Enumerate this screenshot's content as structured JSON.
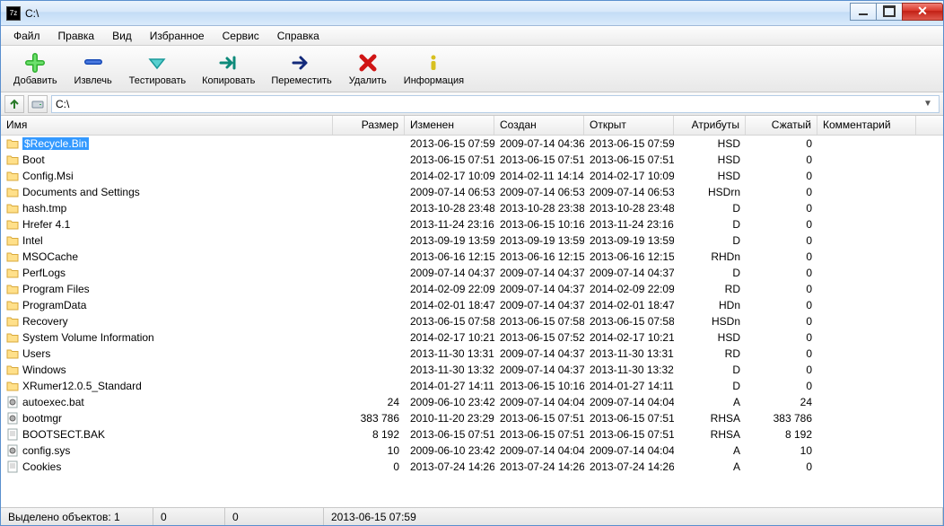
{
  "titlebar": {
    "title": "C:\\"
  },
  "menubar": {
    "items": [
      "Файл",
      "Правка",
      "Вид",
      "Избранное",
      "Сервис",
      "Справка"
    ]
  },
  "toolbar": {
    "buttons": [
      {
        "id": "add",
        "label": "Добавить"
      },
      {
        "id": "extract",
        "label": "Извлечь"
      },
      {
        "id": "test",
        "label": "Тестировать"
      },
      {
        "id": "copy",
        "label": "Копировать"
      },
      {
        "id": "move",
        "label": "Переместить"
      },
      {
        "id": "delete",
        "label": "Удалить"
      },
      {
        "id": "info",
        "label": "Информация"
      }
    ]
  },
  "path": {
    "value": "C:\\"
  },
  "columns": {
    "name": "Имя",
    "size": "Размер",
    "modified": "Изменен",
    "created": "Создан",
    "opened": "Открыт",
    "attrs": "Атрибуты",
    "packed": "Сжатый",
    "comment": "Комментарий"
  },
  "rows": [
    {
      "icon": "folder",
      "name": "$Recycle.Bin",
      "size": "",
      "modified": "2013-06-15 07:59",
      "created": "2009-07-14 04:36",
      "opened": "2013-06-15 07:59",
      "attrs": "HSD",
      "packed": "0",
      "selected": true
    },
    {
      "icon": "folder",
      "name": "Boot",
      "size": "",
      "modified": "2013-06-15 07:51",
      "created": "2013-06-15 07:51",
      "opened": "2013-06-15 07:51",
      "attrs": "HSD",
      "packed": "0"
    },
    {
      "icon": "folder",
      "name": "Config.Msi",
      "size": "",
      "modified": "2014-02-17 10:09",
      "created": "2014-02-11 14:14",
      "opened": "2014-02-17 10:09",
      "attrs": "HSD",
      "packed": "0"
    },
    {
      "icon": "folder",
      "name": "Documents and Settings",
      "size": "",
      "modified": "2009-07-14 06:53",
      "created": "2009-07-14 06:53",
      "opened": "2009-07-14 06:53",
      "attrs": "HSDrn",
      "packed": "0"
    },
    {
      "icon": "folder",
      "name": "hash.tmp",
      "size": "",
      "modified": "2013-10-28 23:48",
      "created": "2013-10-28 23:38",
      "opened": "2013-10-28 23:48",
      "attrs": "D",
      "packed": "0"
    },
    {
      "icon": "folder",
      "name": "Hrefer 4.1",
      "size": "",
      "modified": "2013-11-24 23:16",
      "created": "2013-06-15 10:16",
      "opened": "2013-11-24 23:16",
      "attrs": "D",
      "packed": "0"
    },
    {
      "icon": "folder",
      "name": "Intel",
      "size": "",
      "modified": "2013-09-19 13:59",
      "created": "2013-09-19 13:59",
      "opened": "2013-09-19 13:59",
      "attrs": "D",
      "packed": "0"
    },
    {
      "icon": "folder",
      "name": "MSOCache",
      "size": "",
      "modified": "2013-06-16 12:15",
      "created": "2013-06-16 12:15",
      "opened": "2013-06-16 12:15",
      "attrs": "RHDn",
      "packed": "0"
    },
    {
      "icon": "folder",
      "name": "PerfLogs",
      "size": "",
      "modified": "2009-07-14 04:37",
      "created": "2009-07-14 04:37",
      "opened": "2009-07-14 04:37",
      "attrs": "D",
      "packed": "0"
    },
    {
      "icon": "folder",
      "name": "Program Files",
      "size": "",
      "modified": "2014-02-09 22:09",
      "created": "2009-07-14 04:37",
      "opened": "2014-02-09 22:09",
      "attrs": "RD",
      "packed": "0"
    },
    {
      "icon": "folder",
      "name": "ProgramData",
      "size": "",
      "modified": "2014-02-01 18:47",
      "created": "2009-07-14 04:37",
      "opened": "2014-02-01 18:47",
      "attrs": "HDn",
      "packed": "0"
    },
    {
      "icon": "folder",
      "name": "Recovery",
      "size": "",
      "modified": "2013-06-15 07:58",
      "created": "2013-06-15 07:58",
      "opened": "2013-06-15 07:58",
      "attrs": "HSDn",
      "packed": "0"
    },
    {
      "icon": "folder",
      "name": "System Volume Information",
      "size": "",
      "modified": "2014-02-17 10:21",
      "created": "2013-06-15 07:52",
      "opened": "2014-02-17 10:21",
      "attrs": "HSD",
      "packed": "0"
    },
    {
      "icon": "folder",
      "name": "Users",
      "size": "",
      "modified": "2013-11-30 13:31",
      "created": "2009-07-14 04:37",
      "opened": "2013-11-30 13:31",
      "attrs": "RD",
      "packed": "0"
    },
    {
      "icon": "folder",
      "name": "Windows",
      "size": "",
      "modified": "2013-11-30 13:32",
      "created": "2009-07-14 04:37",
      "opened": "2013-11-30 13:32",
      "attrs": "D",
      "packed": "0"
    },
    {
      "icon": "folder",
      "name": "XRumer12.0.5_Standard",
      "size": "",
      "modified": "2014-01-27 14:11",
      "created": "2013-06-15 10:16",
      "opened": "2014-01-27 14:11",
      "attrs": "D",
      "packed": "0"
    },
    {
      "icon": "gearfile",
      "name": "autoexec.bat",
      "size": "24",
      "modified": "2009-06-10 23:42",
      "created": "2009-07-14 04:04",
      "opened": "2009-07-14 04:04",
      "attrs": "A",
      "packed": "24"
    },
    {
      "icon": "gearfile",
      "name": "bootmgr",
      "size": "383 786",
      "modified": "2010-11-20 23:29",
      "created": "2013-06-15 07:51",
      "opened": "2013-06-15 07:51",
      "attrs": "RHSA",
      "packed": "383 786"
    },
    {
      "icon": "file",
      "name": "BOOTSECT.BAK",
      "size": "8 192",
      "modified": "2013-06-15 07:51",
      "created": "2013-06-15 07:51",
      "opened": "2013-06-15 07:51",
      "attrs": "RHSA",
      "packed": "8 192"
    },
    {
      "icon": "gearfile",
      "name": "config.sys",
      "size": "10",
      "modified": "2009-06-10 23:42",
      "created": "2009-07-14 04:04",
      "opened": "2009-07-14 04:04",
      "attrs": "A",
      "packed": "10"
    },
    {
      "icon": "file",
      "name": "Cookies",
      "size": "0",
      "modified": "2013-07-24 14:26",
      "created": "2013-07-24 14:26",
      "opened": "2013-07-24 14:26",
      "attrs": "A",
      "packed": "0"
    }
  ],
  "statusbar": {
    "selected": "Выделено объектов: 1",
    "c1": "0",
    "c2": "0",
    "c3": "2013-06-15 07:59"
  }
}
